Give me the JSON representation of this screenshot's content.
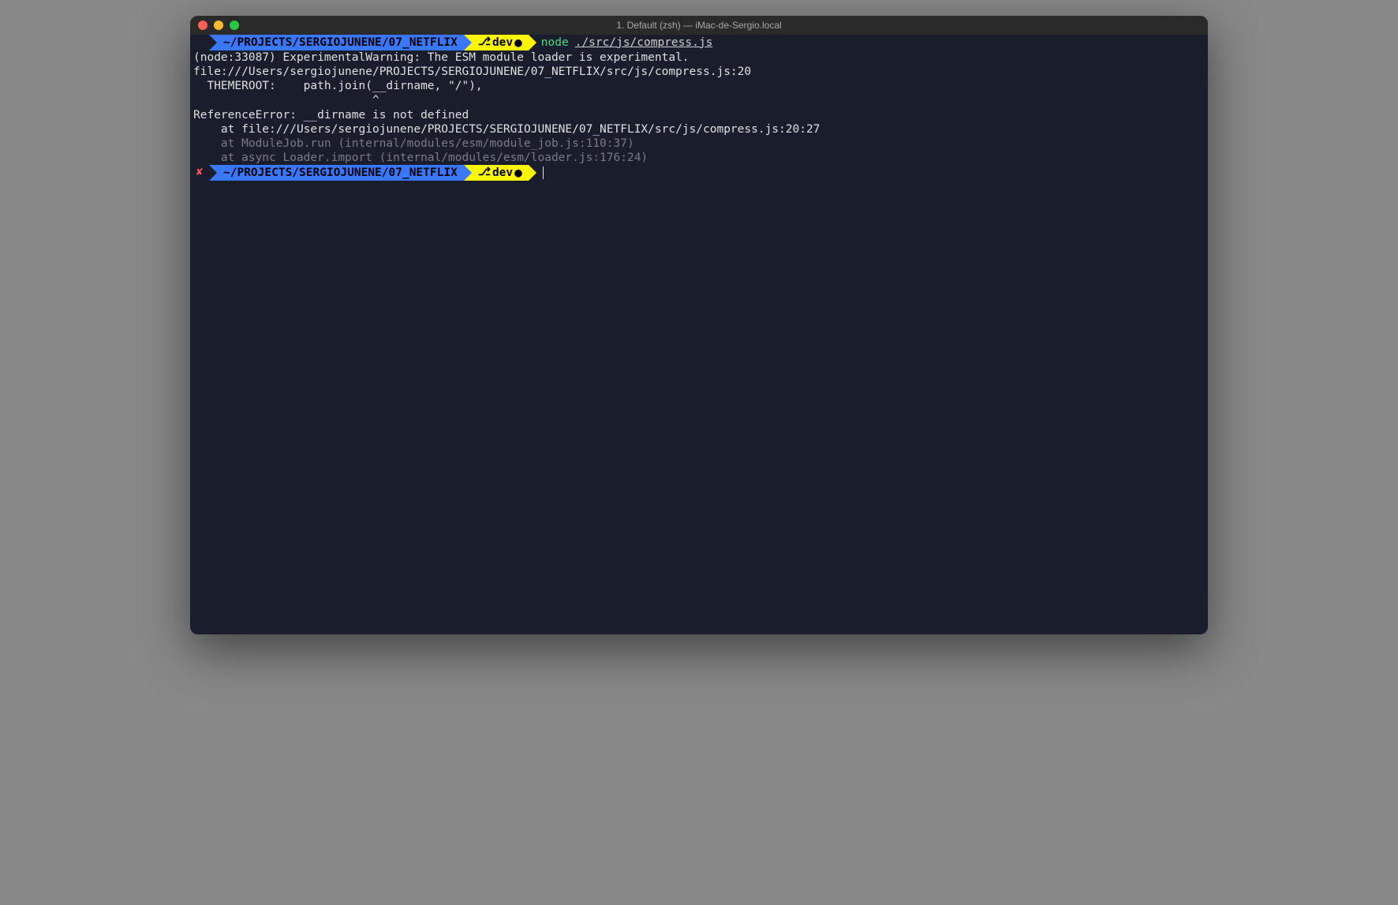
{
  "window": {
    "title": "1. Default (zsh) — iMac-de-Sergio.local"
  },
  "prompt1": {
    "path": "~/PROJECTS/SERGIOJUNENE/07_NETFLIX",
    "branch": "dev",
    "branch_icon": "⎇",
    "dirty": "●",
    "command_bin": "node",
    "command_arg": "./src/js/compress.js"
  },
  "output": {
    "line1": "(node:33087) ExperimentalWarning: The ESM module loader is experimental.",
    "line2": "file:///Users/sergiojunene/PROJECTS/SERGIOJUNENE/07_NETFLIX/src/js/compress.js:20",
    "line3": "  THEMEROOT:    path.join(__dirname, \"/\"),",
    "line4": "                          ^",
    "line5": "",
    "line6": "ReferenceError: __dirname is not defined",
    "line7": "    at file:///Users/sergiojunene/PROJECTS/SERGIOJUNENE/07_NETFLIX/src/js/compress.js:20:27",
    "line8": "    at ModuleJob.run (internal/modules/esm/module_job.js:110:37)",
    "line9": "    at async Loader.import (internal/modules/esm/loader.js:176:24)"
  },
  "prompt2": {
    "status": "✘",
    "path": "~/PROJECTS/SERGIOJUNENE/07_NETFLIX",
    "branch": "dev",
    "branch_icon": "⎇",
    "dirty": "●"
  }
}
